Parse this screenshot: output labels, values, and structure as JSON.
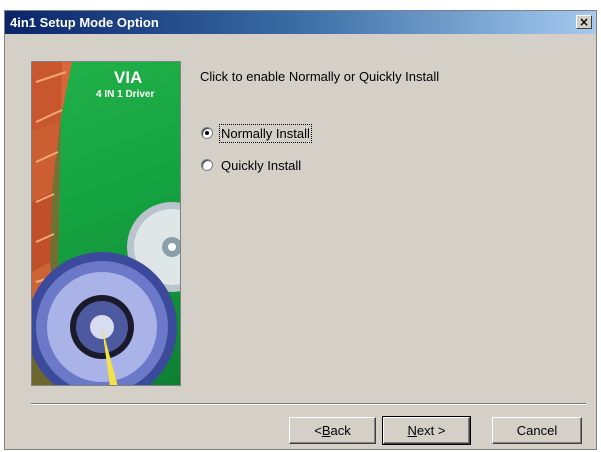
{
  "window": {
    "title": "4in1 Setup Mode Option",
    "close_glyph": "×"
  },
  "banner": {
    "brand": "VIA",
    "subtitle": "4 IN 1 Driver"
  },
  "prompt": "Click to enable Normally or Quickly Install",
  "options": [
    {
      "label": "Normally Install",
      "checked": true
    },
    {
      "label": "Quickly Install",
      "checked": false
    }
  ],
  "buttons": {
    "back": {
      "prefix": "< ",
      "mnemonic": "B",
      "rest": "ack"
    },
    "next": {
      "mnemonic": "N",
      "rest": "ext >"
    },
    "cancel": "Cancel"
  },
  "colors": {
    "dialog_bg": "#d4d0c8",
    "titlebar_start": "#0a246a",
    "titlebar_end": "#a6caf0",
    "banner_green": "#22b04a"
  }
}
